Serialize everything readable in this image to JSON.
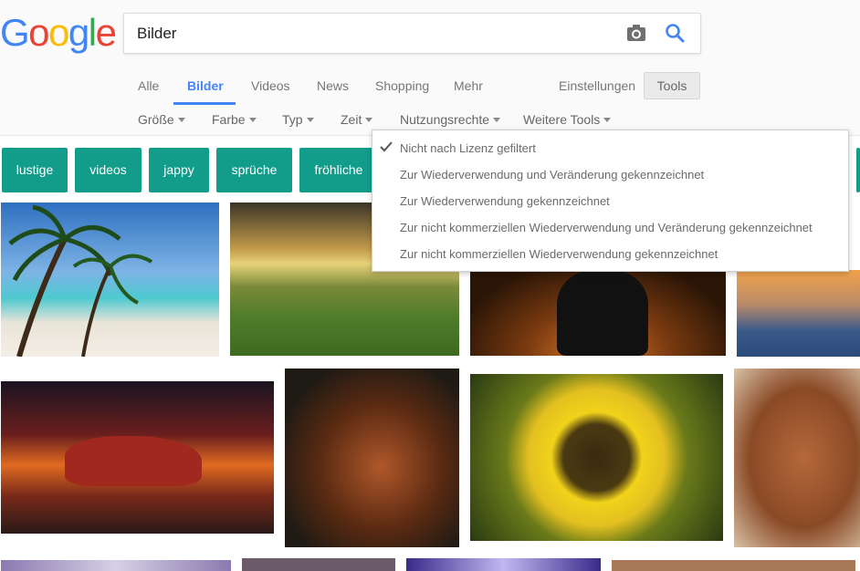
{
  "logo": {
    "letters": [
      "G",
      "o",
      "o",
      "g",
      "l",
      "e"
    ],
    "colors": [
      "#4285F4",
      "#EA4335",
      "#FBBC05",
      "#4285F4",
      "#34A853",
      "#EA4335"
    ]
  },
  "search": {
    "value": "Bilder",
    "camera_icon": "camera-icon",
    "search_icon": "search-icon"
  },
  "tabs": [
    {
      "label": "Alle"
    },
    {
      "label": "Bilder",
      "active": true
    },
    {
      "label": "Videos"
    },
    {
      "label": "News"
    },
    {
      "label": "Shopping"
    },
    {
      "label": "Mehr"
    }
  ],
  "settings_label": "Einstellungen",
  "tools_label": "Tools",
  "filters": [
    {
      "label": "Größe"
    },
    {
      "label": "Farbe"
    },
    {
      "label": "Typ"
    },
    {
      "label": "Zeit"
    },
    {
      "label": "Nutzungsrechte"
    },
    {
      "label": "Weitere Tools"
    }
  ],
  "chips": [
    {
      "label": "lustige"
    },
    {
      "label": "videos"
    },
    {
      "label": "jappy"
    },
    {
      "label": "sprüche"
    },
    {
      "label": "fröhliche"
    }
  ],
  "usage_menu": {
    "items": [
      {
        "label": "Nicht nach Lizenz gefiltert",
        "checked": true
      },
      {
        "label": "Zur Wiederverwendung und Veränderung gekennzeichnet"
      },
      {
        "label": "Zur Wiederverwendung gekennzeichnet"
      },
      {
        "label": "Zur nicht kommerziellen Wiederverwendung und Veränderung gekennzeichnet"
      },
      {
        "label": "Zur nicht kommerziellen Wiederverwendung gekennzeichnet"
      }
    ]
  },
  "colors": {
    "accent": "#4285F4",
    "chip": "#129C8A"
  }
}
